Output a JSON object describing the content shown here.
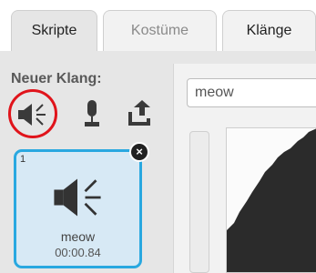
{
  "tabs": {
    "scripts": "Skripte",
    "costumes": "Kostüme",
    "sounds": "Klänge"
  },
  "new_sound": {
    "label": "Neuer Klang:",
    "tools": [
      "speaker-icon",
      "microphone-icon",
      "upload-icon"
    ]
  },
  "sound_item": {
    "number": "1",
    "name": "meow",
    "duration": "00:00.84",
    "delete_symbol": "×"
  },
  "editor": {
    "name_value": "meow"
  },
  "colors": {
    "selection_border": "#29a8e0",
    "highlight_circle": "#e0141b",
    "icon_dark": "#3a3a3a"
  }
}
